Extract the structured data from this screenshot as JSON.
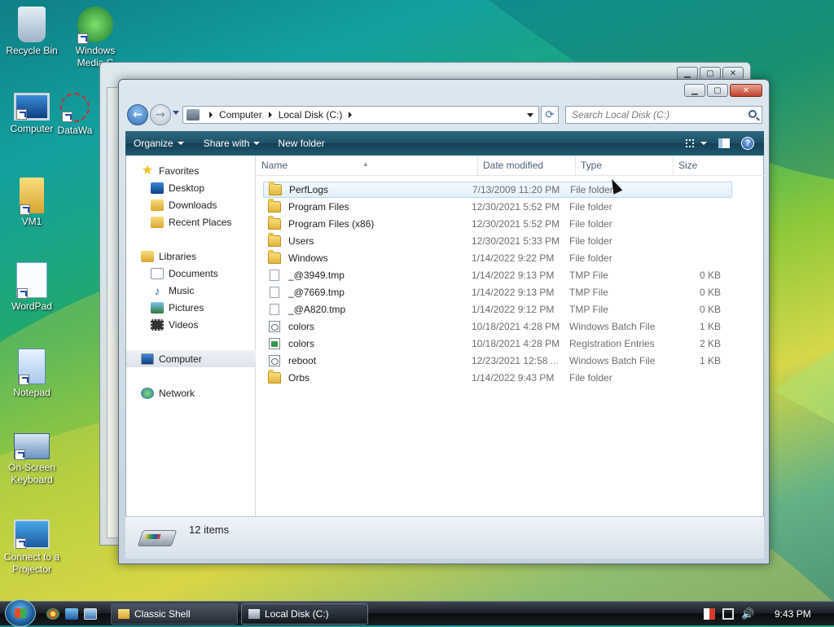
{
  "desktop": {
    "icons": [
      {
        "label": "Recycle Bin",
        "icon": "recycle-bin-icon"
      },
      {
        "label": "Windows Media C",
        "icon": "windows-media-center-icon"
      },
      {
        "label": "Computer",
        "icon": "computer-icon"
      },
      {
        "label": "DataWa",
        "icon": "datawa-icon"
      },
      {
        "label": "VM1",
        "icon": "user-folder-icon"
      },
      {
        "label": "WordPad",
        "icon": "wordpad-icon"
      },
      {
        "label": "Notepad",
        "icon": "notepad-icon"
      },
      {
        "label": "On-Screen Keyboard",
        "icon": "keyboard-icon"
      },
      {
        "label": "Connect to a Projector",
        "icon": "projector-icon"
      }
    ]
  },
  "explorer": {
    "breadcrumb": [
      "Computer",
      "Local Disk (C:)"
    ],
    "search_placeholder": "Search Local Disk (C:)",
    "toolbar": {
      "organize": "Organize",
      "share_with": "Share with",
      "new_folder": "New folder"
    },
    "nav": {
      "favorites": "Favorites",
      "desktop": "Desktop",
      "downloads": "Downloads",
      "recent_places": "Recent Places",
      "libraries": "Libraries",
      "documents": "Documents",
      "music": "Music",
      "pictures": "Pictures",
      "videos": "Videos",
      "computer": "Computer",
      "network": "Network"
    },
    "columns": {
      "name": "Name",
      "date": "Date modified",
      "type": "Type",
      "size": "Size"
    },
    "files": [
      {
        "name": "PerfLogs",
        "date": "7/13/2009 11:20 PM",
        "type": "File folder",
        "size": "",
        "icon": "folder-icon"
      },
      {
        "name": "Program Files",
        "date": "12/30/2021 5:52 PM",
        "type": "File folder",
        "size": "",
        "icon": "folder-icon"
      },
      {
        "name": "Program Files (x86)",
        "date": "12/30/2021 5:52 PM",
        "type": "File folder",
        "size": "",
        "icon": "folder-icon"
      },
      {
        "name": "Users",
        "date": "12/30/2021 5:33 PM",
        "type": "File folder",
        "size": "",
        "icon": "folder-icon"
      },
      {
        "name": "Windows",
        "date": "1/14/2022 9:22 PM",
        "type": "File folder",
        "size": "",
        "icon": "folder-icon"
      },
      {
        "name": "_@3949.tmp",
        "date": "1/14/2022 9:13 PM",
        "type": "TMP File",
        "size": "0 KB",
        "icon": "file-icon"
      },
      {
        "name": "_@7669.tmp",
        "date": "1/14/2022 9:13 PM",
        "type": "TMP File",
        "size": "0 KB",
        "icon": "file-icon"
      },
      {
        "name": "_@A820.tmp",
        "date": "1/14/2022 9:12 PM",
        "type": "TMP File",
        "size": "0 KB",
        "icon": "file-icon"
      },
      {
        "name": "colors",
        "date": "10/18/2021 4:28 PM",
        "type": "Windows Batch File",
        "size": "1 KB",
        "icon": "batch-file-icon"
      },
      {
        "name": "colors",
        "date": "10/18/2021 4:28 PM",
        "type": "Registration Entries",
        "size": "2 KB",
        "icon": "registry-file-icon"
      },
      {
        "name": "reboot",
        "date": "12/23/2021 12:58 ...",
        "type": "Windows Batch File",
        "size": "1 KB",
        "icon": "batch-file-icon"
      },
      {
        "name": "Orbs",
        "date": "1/14/2022 9:43 PM",
        "type": "File folder",
        "size": "",
        "icon": "folder-icon"
      }
    ],
    "status": {
      "item_count": "12 items"
    }
  },
  "taskbar": {
    "buttons": [
      {
        "label": "Classic Shell"
      },
      {
        "label": "Local Disk (C:)"
      }
    ],
    "clock": "9:43 PM"
  },
  "colors": {
    "accent": "#1d4f66",
    "selection": "#e3effb"
  }
}
